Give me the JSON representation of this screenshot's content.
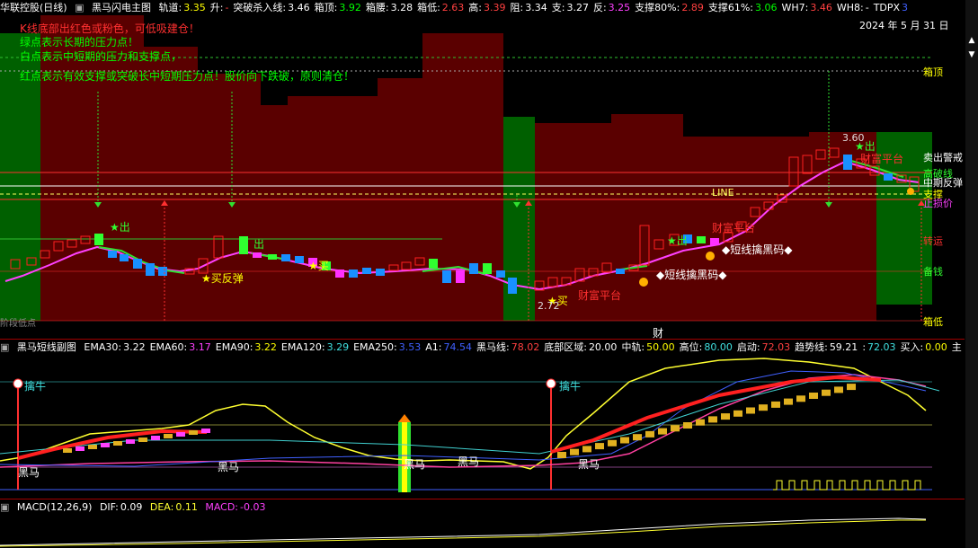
{
  "main_header": {
    "title": "华联控股(日线)",
    "indicator": "黑马闪电主图",
    "items": [
      {
        "label": "轨道:",
        "value": "3.35",
        "color": "#ffff00"
      },
      {
        "label": "升:",
        "value": "-",
        "color": "#ff4040"
      },
      {
        "label": "突破杀入线:",
        "value": "3.46",
        "color": "#ffffff"
      },
      {
        "label": "箱顶:",
        "value": "3.92",
        "color": "#00ff00"
      },
      {
        "label": "箱腰:",
        "value": "3.28",
        "color": "#ffffff"
      },
      {
        "label": "箱低:",
        "value": "2.63",
        "color": "#ff4040"
      },
      {
        "label": "高:",
        "value": "3.39",
        "color": "#ff4040"
      },
      {
        "label": "阻:",
        "value": "3.34",
        "color": "#ffffff"
      },
      {
        "label": "支:",
        "value": "3.27",
        "color": "#ffffff"
      },
      {
        "label": "反:",
        "value": "3.25",
        "color": "#ff40ff"
      },
      {
        "label": "支撑80%:",
        "value": "2.89",
        "color": "#ff4040"
      },
      {
        "label": "支撑61%:",
        "value": "3.06",
        "color": "#00ff00"
      },
      {
        "label": "WH7:",
        "value": "3.46",
        "color": "#ff4040"
      },
      {
        "label": "WH8:",
        "value": "-",
        "color": "#ffffff"
      },
      {
        "label": "TDPX",
        "value": "3",
        "color": "#4060ff"
      }
    ],
    "date": "2024 年 5 月 31 日"
  },
  "legend_notes": [
    {
      "text": "K线底部出红色或粉色，可低吸建仓！",
      "color": "#ff3030"
    },
    {
      "text": "绿点表示长期的压力点！",
      "color": "#00ff00"
    },
    {
      "text": "白点表示中短期的压力和支撑点，",
      "color": "#00ff00"
    },
    {
      "text": "红点表示有效支撑或突破长中短期压力点！股价向下跌破，原则清仓！",
      "color": "#00ff00"
    }
  ],
  "main_annotations": {
    "out1": "★出",
    "out2": "出",
    "out3": "★出",
    "out4": "★出",
    "buy1": "★买反弹",
    "buy2": "★买",
    "buy3": "★买",
    "low_price": "2.72",
    "high_price": "3.60",
    "platform1": "财富平台",
    "platform2": "财富平台",
    "platform3": "财富平台",
    "hold1": "◆短线擒黑码◆",
    "hold2": "◆短线擒黑码◆",
    "line_label": "LINE",
    "bottom_label": "财",
    "left_bottom": "阶段低点"
  },
  "right_labels": {
    "box_top": "箱顶",
    "top_stack": "卖出警戒",
    "break_line": "高破线",
    "rebound": "中期反弹",
    "support": "支撑",
    "stop": "止损价",
    "rally": "转运",
    "prep": "备钱",
    "box_low": "箱低"
  },
  "sub_header": {
    "title": "黑马短线副图",
    "items": [
      {
        "label": "EMA30:",
        "value": "3.22",
        "color": "#ffffff"
      },
      {
        "label": "EMA60:",
        "value": "3.17",
        "color": "#ff40ff"
      },
      {
        "label": "EMA90:",
        "value": "3.22",
        "color": "#ffff00"
      },
      {
        "label": "EMA120:",
        "value": "3.29",
        "color": "#40e0e0"
      },
      {
        "label": "EMA250:",
        "value": "3.53",
        "color": "#4060ff"
      },
      {
        "label": "A1:",
        "value": "74.54",
        "color": "#4060ff"
      },
      {
        "label": "黑马线:",
        "value": "78.02",
        "color": "#ff4040"
      },
      {
        "label": "底部区域:",
        "value": "20.00",
        "color": "#ffffff"
      },
      {
        "label": "中轨:",
        "value": "50.00",
        "color": "#ffff00"
      },
      {
        "label": "高位:",
        "value": "80.00",
        "color": "#40e0e0"
      },
      {
        "label": "启动:",
        "value": "72.03",
        "color": "#ff4040"
      },
      {
        "label": "趋势线:",
        "value": "59.21",
        "color": "#ffffff"
      },
      {
        "label": ":",
        "value": "72.03",
        "color": "#40e0e0"
      },
      {
        "label": "买入:",
        "value": "0.00",
        "color": "#ffff00"
      },
      {
        "label": "主",
        "value": "",
        "color": "#ffff00"
      }
    ],
    "catch1": "擒牛",
    "catch2": "擒牛",
    "hm1": "黑马",
    "hm2": "黑马",
    "hm3": "黑马",
    "hm4": "黑马",
    "hm5": "黑马"
  },
  "macd_header": {
    "title": "MACD(12,26,9)",
    "dif_label": "DIF:",
    "dif": "0.09",
    "dea_label": "DEA:",
    "dea": "0.11",
    "macd_label": "MACD:",
    "macd": "-0.03"
  },
  "colors": {
    "bg": "#000000",
    "zone": "#5a0000",
    "zone_green": "#005000",
    "up": "#ff2020",
    "down": "#00a0ff",
    "ma": "#ff40ff"
  }
}
